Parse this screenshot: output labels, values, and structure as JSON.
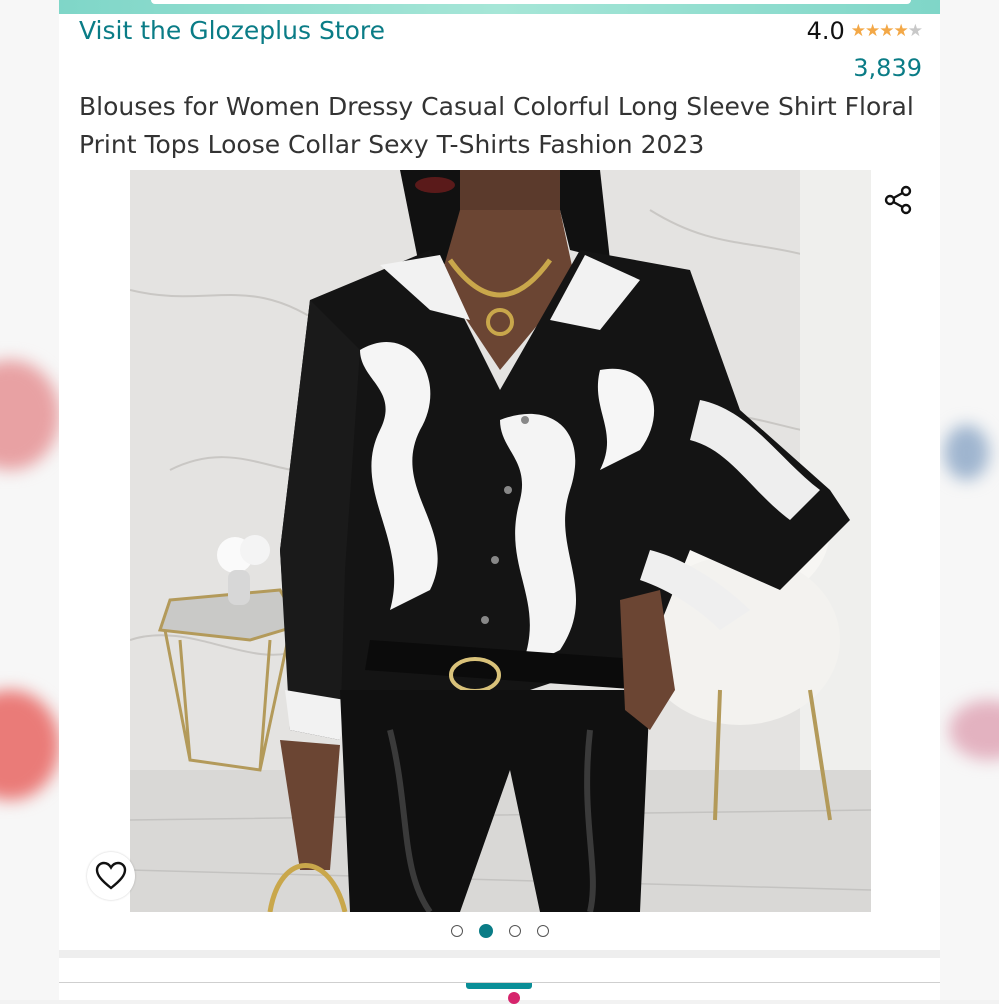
{
  "store": {
    "link_text": "Visit the Glozeplus Store"
  },
  "rating": {
    "value": "4.0",
    "stars_filled": 4,
    "stars_total": 5,
    "count": "3,839"
  },
  "product": {
    "title": "Blouses for Women Dressy Casual Colorful Long Sleeve Shirt Floral Print Tops Loose Collar Sexy T-Shirts Fashion 2023"
  },
  "image": {
    "total_images": 4,
    "active_index": 1
  },
  "icons": {
    "share": "share-icon",
    "wishlist": "heart-outline-icon"
  },
  "colors": {
    "link": "#0a7c86",
    "star": "#f3a847",
    "active_dot": "#0a7c86",
    "accent_bar": "#0a8e97"
  }
}
